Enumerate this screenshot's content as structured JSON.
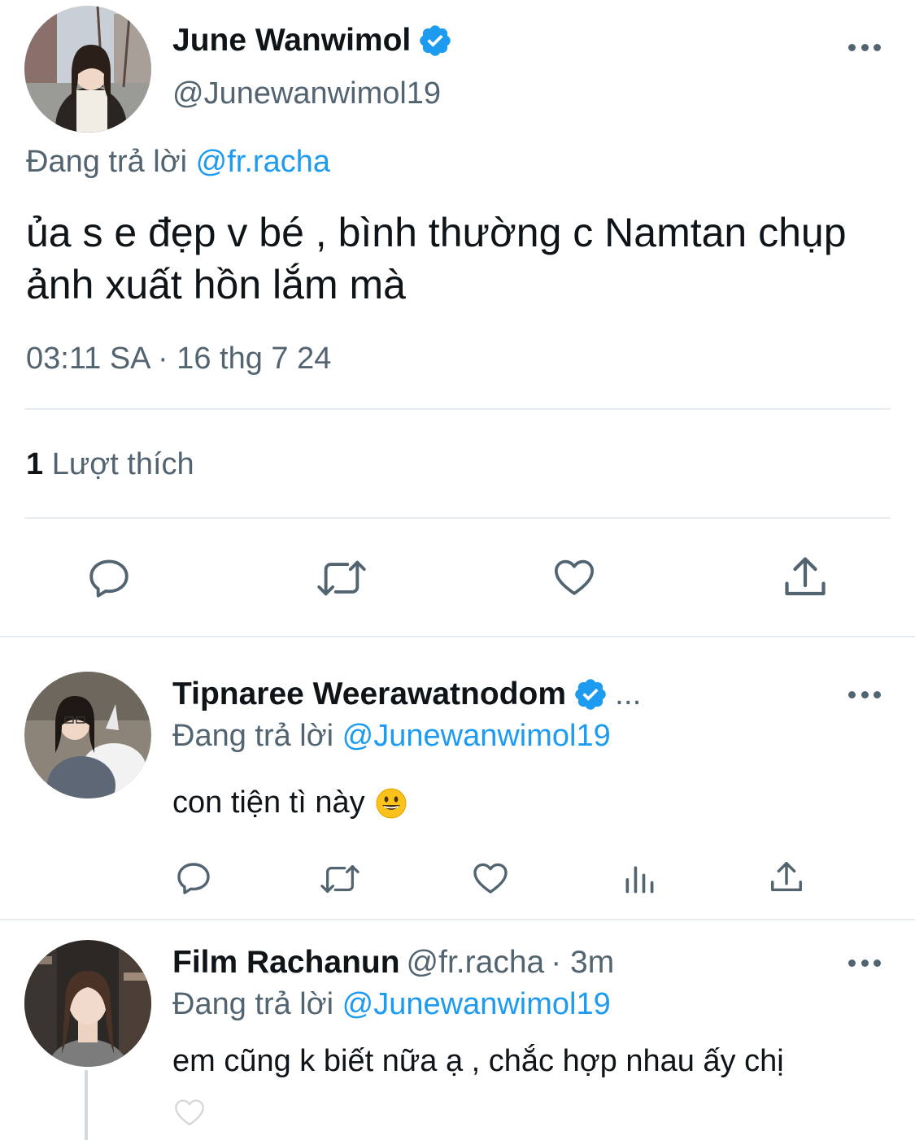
{
  "main_tweet": {
    "name": "June Wanwimol",
    "handle": "@Junewanwimol19",
    "reply_prefix": "Đang trả lời",
    "reply_mention": "@fr.racha",
    "text": "ủa s e đẹp v bé , bình thường c Namtan chụp ảnh xuất hồn lắm mà",
    "timestamp": "03:11 SA · 16 thg 7 24",
    "like_count": "1",
    "like_label": "Lượt thích"
  },
  "replies": [
    {
      "name": "Tipnaree Weerawatnodom",
      "suffix": "...",
      "reply_prefix": "Đang trả lời",
      "reply_mention": "@Junewanwimol19",
      "text": "con tiện tì này",
      "emoji": "😀"
    },
    {
      "name": "Film Rachanun",
      "handle": "@fr.racha",
      "time": "· 3m",
      "reply_prefix": "Đang trả lời",
      "reply_mention": "@Junewanwimol19",
      "text": "em cũng k biết nữa ạ , chắc hợp nhau ấy chị"
    }
  ],
  "icons": {
    "verified": "verified-badge-icon",
    "more": "more-options-icon",
    "reply": "reply-icon",
    "retweet": "retweet-icon",
    "like": "heart-icon",
    "views": "analytics-icon",
    "share": "share-icon"
  },
  "colors": {
    "accent": "#1d9bf0",
    "secondary_text": "#536471",
    "icon": "#536471",
    "divider": "#e6ecf0"
  }
}
